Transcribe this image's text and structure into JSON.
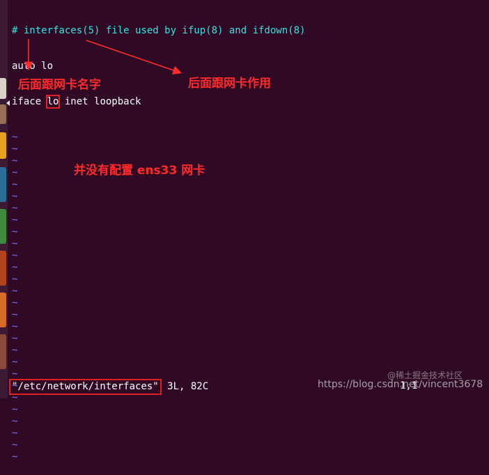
{
  "editor": {
    "lines": [
      {
        "type": "comment",
        "text": "# interfaces(5) file used by ifup(8) and ifdown(8)"
      },
      {
        "type": "text",
        "text": "auto lo"
      },
      {
        "type": "iface",
        "prefix": "iface ",
        "highlight": "lo",
        "suffix": " inet loopback"
      }
    ],
    "tilde": "~",
    "empty_line_count": 28
  },
  "status_bar": {
    "file": "\"/etc/network/interfaces\"",
    "info": " 3L, 82C",
    "position": "1,1"
  },
  "annotations": {
    "card_name": "后面跟网卡名字",
    "card_role": "后面跟网卡作用",
    "no_ens33": "并没有配置 ens33 网卡"
  },
  "watermark": {
    "url": "https://blog.csdn.net/vincent3678",
    "site": "@稀土掘金技术社区"
  },
  "colors": {
    "background": "#300a24",
    "comment": "#34e2e2",
    "tilde": "#6f77ff",
    "annotation": "#ff2a2a"
  }
}
